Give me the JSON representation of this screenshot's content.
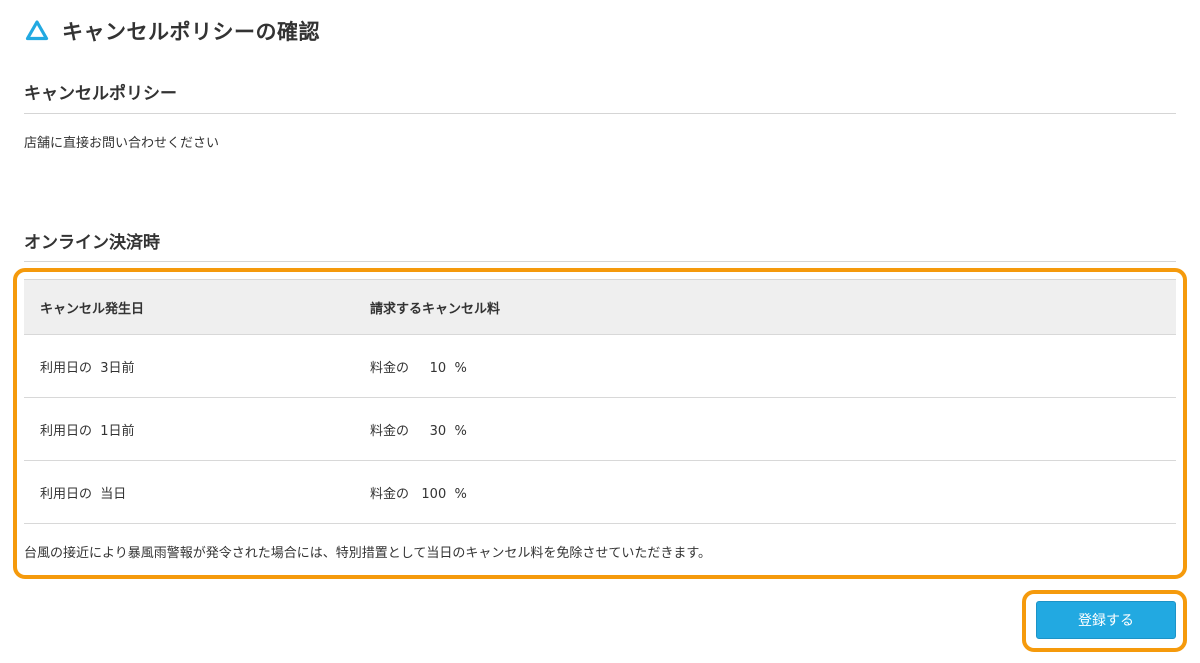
{
  "header": {
    "title": "キャンセルポリシーの確認",
    "logo_icon": "triangle-logo-icon",
    "accent_color": "#22a9e1"
  },
  "policy_section": {
    "title": "キャンセルポリシー",
    "text": "店舗に直接お問い合わせください"
  },
  "online_section": {
    "title": "オンライン決済時",
    "table": {
      "headers": [
        "キャンセル発生日",
        "請求するキャンセル料"
      ],
      "rows": [
        [
          "利用日の  3日前",
          "料金の     10  %"
        ],
        [
          "利用日の  1日前",
          "料金の     30  %"
        ],
        [
          "利用日の  当日",
          "料金の   100  %"
        ]
      ]
    },
    "note": "台風の接近により暴風雨警報が発令された場合には、特別措置として当日のキャンセル料を免除させていただきます。"
  },
  "actions": {
    "register_label": "登録する"
  },
  "highlight_color": "#f59a0c"
}
